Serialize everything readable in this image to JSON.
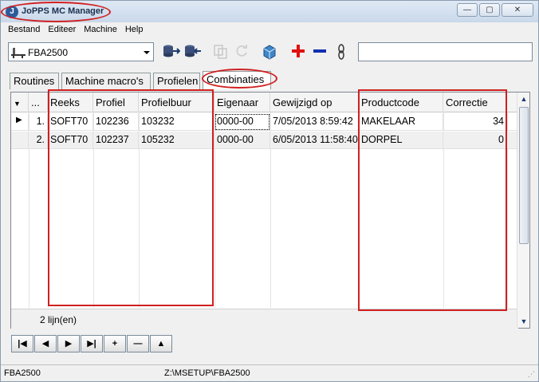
{
  "window": {
    "title": "JoPPS MC Manager",
    "minimize": "—",
    "maximize": "▢",
    "close": "✕"
  },
  "menu": [
    "Bestand",
    "Editeer",
    "Machine",
    "Help"
  ],
  "toolbar": {
    "database": "FBA2500",
    "search_value": ""
  },
  "tabs": [
    "Routines",
    "Machine macro's",
    "Profielen",
    "Combinaties"
  ],
  "active_tab": "Combinaties",
  "grid": {
    "columns": [
      "",
      "...",
      "Reeks",
      "Profiel",
      "Profielbuur",
      "Eigenaar",
      "Gewijzigd op",
      "Productcode",
      "Correctie"
    ],
    "rows": [
      {
        "indicator": "▶",
        "num": "1.",
        "reeks": "SOFT70",
        "profiel": "102236",
        "profielbuur": "103232",
        "eigenaar": "0000-00",
        "gewijzigd": "7/05/2013 8:59:42",
        "productcode": "MAKELAAR",
        "correctie": "34"
      },
      {
        "indicator": "",
        "num": "2.",
        "reeks": "SOFT70",
        "profiel": "102237",
        "profielbuur": "105232",
        "eigenaar": "0000-00",
        "gewijzigd": "6/05/2013 11:58:40",
        "productcode": "DORPEL",
        "correctie": "0"
      }
    ],
    "footer": "2 lijn(en)"
  },
  "navigator": [
    "|◀",
    "◀",
    "▶",
    "▶|",
    "+",
    "—",
    "▲"
  ],
  "status": {
    "left": "FBA2500",
    "path": "Z:\\MSETUP\\FBA2500"
  },
  "colors": {
    "annotation": "#d02020",
    "add": "#e01010",
    "remove": "#1030b0"
  }
}
